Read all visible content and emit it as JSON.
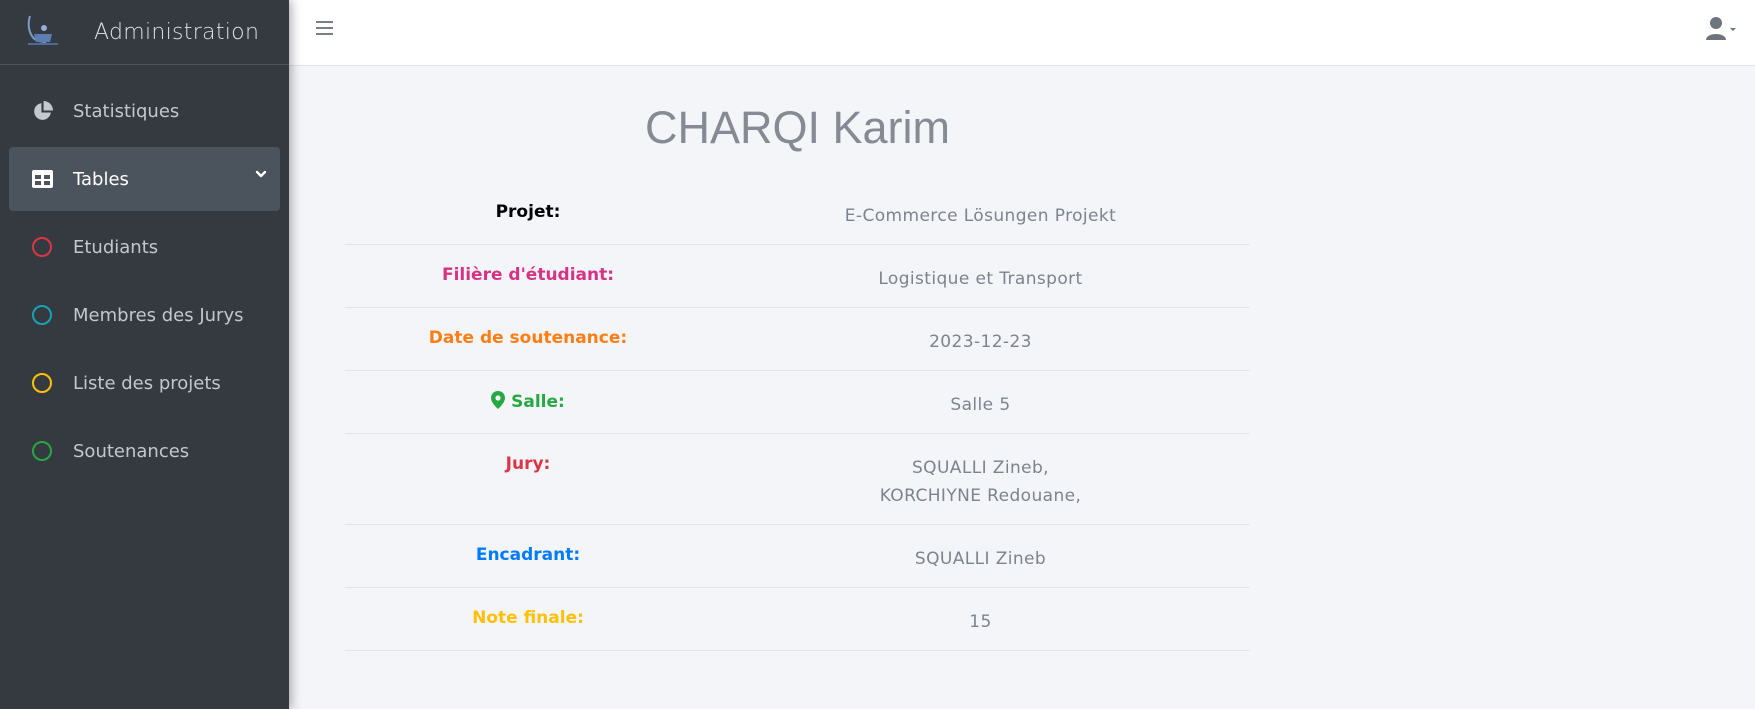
{
  "sidebar": {
    "brand_title": "Administration",
    "items": [
      {
        "label": "Statistiques",
        "icon": "chart-pie-icon"
      },
      {
        "label": "Tables",
        "icon": "table-icon"
      },
      {
        "label": "Etudiants",
        "icon": "circle-icon",
        "color": "#dc3545"
      },
      {
        "label": "Membres des Jurys",
        "icon": "circle-icon",
        "color": "#17a2b8"
      },
      {
        "label": "Liste des projets",
        "icon": "circle-icon",
        "color": "#ffc107"
      },
      {
        "label": "Soutenances",
        "icon": "circle-icon",
        "color": "#28a745"
      }
    ]
  },
  "student": {
    "name": "CHARQI Karim"
  },
  "details": {
    "projet": {
      "label": "Projet:",
      "value": "E-Commerce Lösungen Projekt",
      "color": "#000000"
    },
    "filiere": {
      "label": "Filière d'étudiant:",
      "value": "Logistique et Transport",
      "color": "#d63384"
    },
    "date": {
      "label": "Date de soutenance:",
      "value": "2023-12-23",
      "color": "#fd7e14"
    },
    "salle": {
      "label": "Salle:",
      "value": "Salle 5",
      "color": "#28a745"
    },
    "jury": {
      "label": "Jury:",
      "values": [
        "SQUALLI Zineb,",
        "KORCHIYNE Redouane,"
      ],
      "color": "#dc3545"
    },
    "encadrant": {
      "label": "Encadrant:",
      "value": "SQUALLI Zineb",
      "color": "#007bff"
    },
    "note": {
      "label": "Note finale:",
      "value": "15",
      "color": "#ffc107"
    }
  }
}
